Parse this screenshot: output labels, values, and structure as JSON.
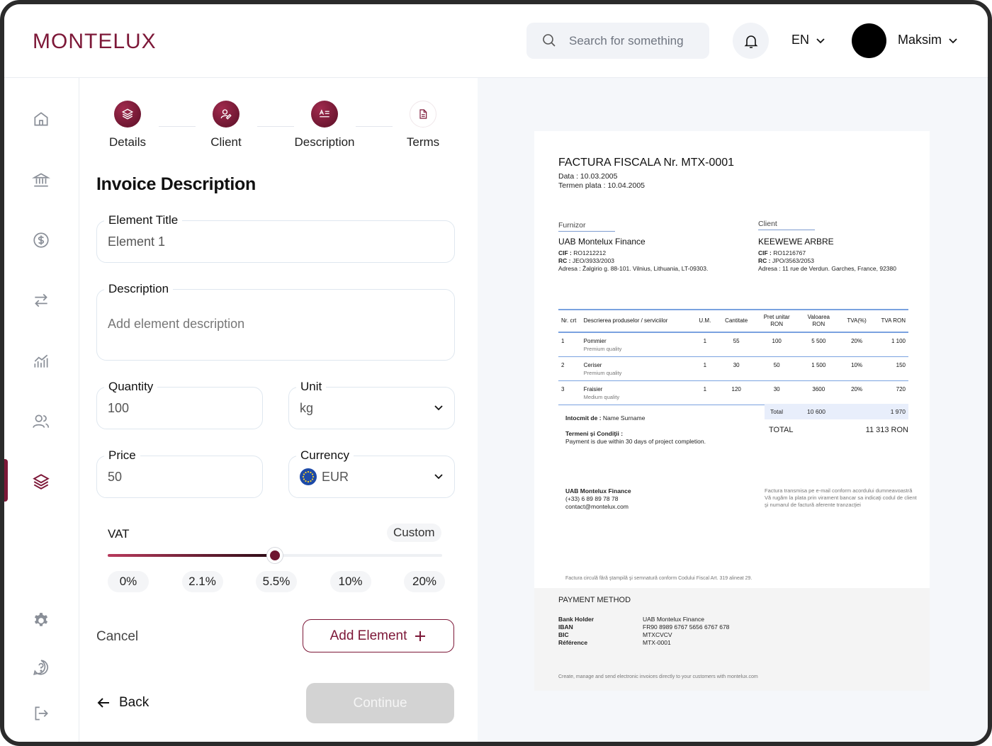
{
  "brand": {
    "logo_text": "MONTELUX",
    "accent": "#7d1838"
  },
  "header": {
    "search_placeholder": "Search for something",
    "language": "EN",
    "user_name": "Maksim"
  },
  "sidebar": {
    "items": [
      {
        "icon": "home-icon"
      },
      {
        "icon": "bank-icon"
      },
      {
        "icon": "dollar-icon"
      },
      {
        "icon": "transfer-icon"
      },
      {
        "icon": "chart-icon"
      },
      {
        "icon": "users-icon"
      },
      {
        "icon": "layers-icon",
        "active": true
      },
      {
        "icon": "gear-icon"
      },
      {
        "icon": "help-icon"
      },
      {
        "icon": "logout-icon"
      }
    ]
  },
  "steps": [
    {
      "label": "Details",
      "done": true
    },
    {
      "label": "Client",
      "done": true
    },
    {
      "label": "Description",
      "done": true
    },
    {
      "label": "Terms",
      "done": false
    }
  ],
  "form": {
    "title": "Invoice Description",
    "element_title_label": "Element Title",
    "element_title_value": "Element 1",
    "description_label": "Description",
    "description_placeholder": "Add element description",
    "quantity_label": "Quantity",
    "quantity_value": "100",
    "unit_label": "Unit",
    "unit_value": "kg",
    "price_label": "Price",
    "price_value": "50",
    "currency_label": "Currency",
    "currency_value": "EUR",
    "vat_label": "VAT",
    "vat_custom": "Custom",
    "vat_options": [
      "0%",
      "2.1%",
      "5.5%",
      "10%",
      "20%"
    ],
    "vat_selected_fraction": 0.5,
    "cancel_label": "Cancel",
    "add_element_label": "Add Element",
    "back_label": "Back",
    "continue_label": "Continue"
  },
  "invoice": {
    "title": "FACTURA FISCALA Nr. MTX-0001",
    "date_line": "Data : 10.03.2005",
    "due_line": "Termen plata : 10.04.2005",
    "supplier_heading": "Furnizor",
    "supplier_name": "UAB Montelux Finance",
    "supplier_cif_label": "CIF :",
    "supplier_cif": " RO1212212",
    "supplier_rc_label": "RC :",
    "supplier_rc": " JEO/3933/2003",
    "supplier_address": "Adresa : Žalgirio g. 88-101. Vilnius, Lithuania, LT-09303.",
    "client_heading": "Client",
    "client_name": "KEEWEWE ARBRE",
    "client_cif_label": "CIF :",
    "client_cif": " RO1216767",
    "client_rc_label": "RC :",
    "client_rc": " JPO/3563/2053",
    "client_address": "Adresa : 11 rue de Verdun. Garches, France, 92380",
    "table_headers": [
      "Nr. crt",
      "Descrierea produselor / serviciilor",
      "U.M.",
      "Cantitate",
      "Pret unitar RON",
      "Valoarea RON",
      "TVA(%)",
      "TVA RON"
    ],
    "rows": [
      {
        "nr": "1",
        "name": "Pommier",
        "quality": "Premium quality",
        "um": "1",
        "qty": "55",
        "unit_price": "100",
        "value": "5 500",
        "vat_pct": "20%",
        "vat": "1 100"
      },
      {
        "nr": "2",
        "name": "Ceriser",
        "quality": "Premium quality",
        "um": "1",
        "qty": "30",
        "unit_price": "50",
        "value": "1 500",
        "vat_pct": "10%",
        "vat": "150"
      },
      {
        "nr": "3",
        "name": "Fraisier",
        "quality": "Medium quality",
        "um": "1",
        "qty": "120",
        "unit_price": "30",
        "value": "3600",
        "vat_pct": "20%",
        "vat": "720"
      }
    ],
    "total_label": "Total",
    "total_value": "10 600",
    "total_vat": "1 970",
    "grand_total_label": "TOTAL",
    "grand_total_value": "11 313 RON",
    "issued_by_label": "Intocmit de :",
    "issued_by": " Name Surname",
    "terms_heading": "Termeni şi Condiţii :",
    "terms_text": "Payment is due within 30 days of project completion.",
    "footer_company": "UAB Montelux Finance",
    "footer_phone": "(+33) 6 89 89 78 78",
    "footer_email": "contact@montelux.com",
    "footer_note_1": "Factura transmisa pe e-mail conform acordului dumneavoastră",
    "footer_note_2": "Vă rugăm la plata prin virament bancar sa indicaţi codul de client",
    "footer_note_3": "şi numarul de factură aferente tranzacţiei",
    "legal_note": "Factura circulă fără ştampilă şi semnatură conform Codului Fiscal Art. 319 alineat 29.",
    "payment_heading": "PAYMENT METHOD",
    "bank_holder_label": "Bank Holder",
    "bank_holder": "UAB Montelux Finance",
    "iban_label": "IBAN",
    "iban": "FR90 8989 6767 5656 6767 678",
    "bic_label": "BIC",
    "bic": "MTXCVCV",
    "reference_label": "Référence",
    "reference": "MTX-0001",
    "bottom_note": "Create, manage and send electronic invoices directly to your customers with montelux.com"
  }
}
